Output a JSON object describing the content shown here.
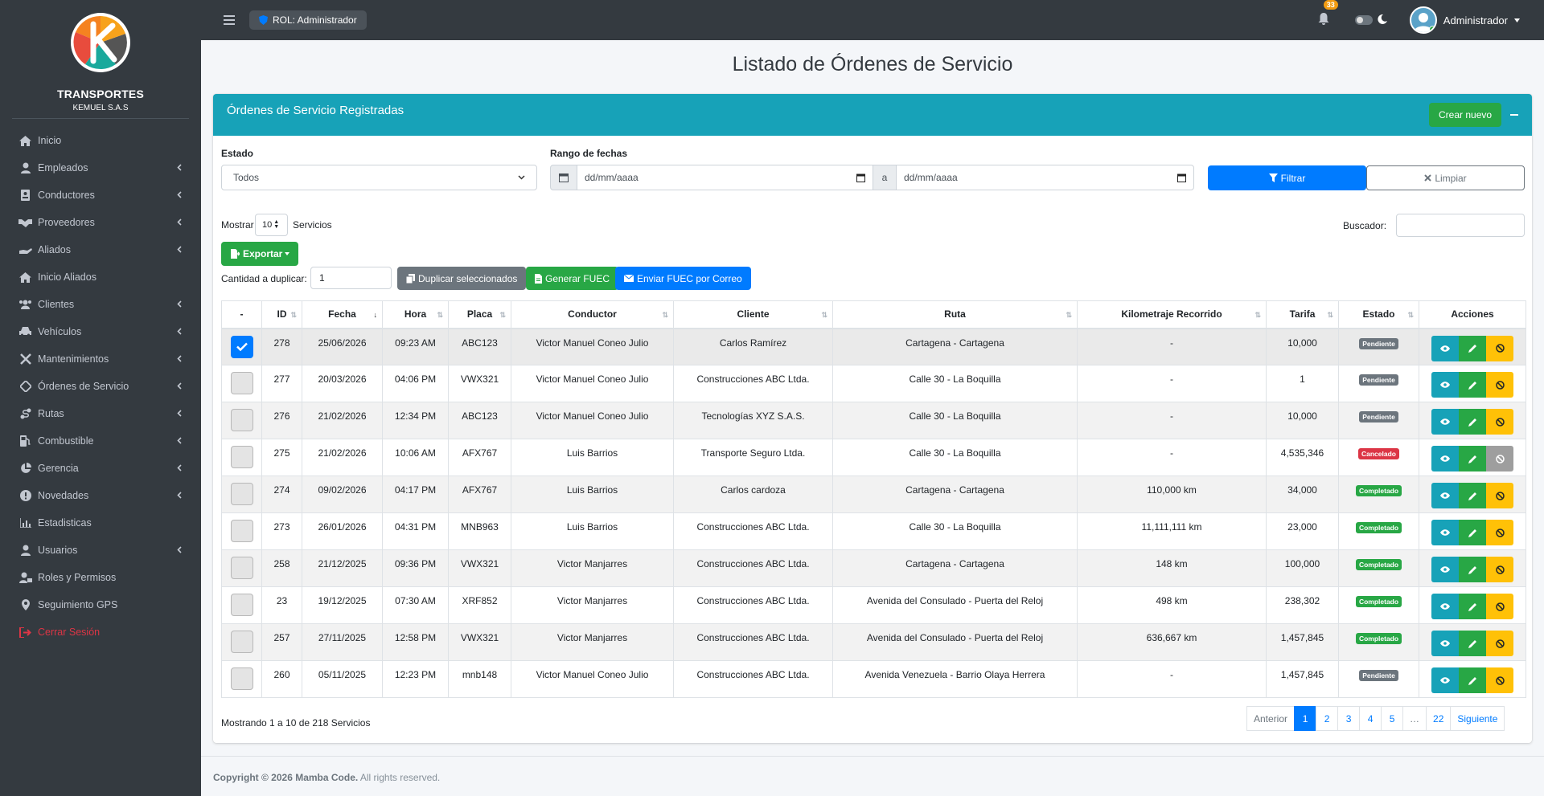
{
  "brand": {
    "name": "TRANSPORTES",
    "subtitle": "KEMUEL S.A.S"
  },
  "sidebar": {
    "items": [
      {
        "label": "Inicio",
        "icon": "home-icon",
        "arrow": false
      },
      {
        "label": "Empleados",
        "icon": "user-tie-icon",
        "arrow": true
      },
      {
        "label": "Conductores",
        "icon": "id-card-icon",
        "arrow": true
      },
      {
        "label": "Proveedores",
        "icon": "handshake-icon",
        "arrow": true
      },
      {
        "label": "Aliados",
        "icon": "hand-holding-icon",
        "arrow": true
      },
      {
        "label": "Inicio Aliados",
        "icon": "home-icon",
        "arrow": false
      },
      {
        "label": "Clientes",
        "icon": "users-icon",
        "arrow": true
      },
      {
        "label": "Vehículos",
        "icon": "car-icon",
        "arrow": true
      },
      {
        "label": "Mantenimientos",
        "icon": "tools-icon",
        "arrow": true
      },
      {
        "label": "Órdenes de Servicio",
        "icon": "clipboard-icon",
        "arrow": true
      },
      {
        "label": "Rutas",
        "icon": "route-icon",
        "arrow": true
      },
      {
        "label": "Combustible",
        "icon": "gas-pump-icon",
        "arrow": true
      },
      {
        "label": "Gerencia",
        "icon": "chart-pie-icon",
        "arrow": true
      },
      {
        "label": "Novedades",
        "icon": "exclamation-circle-icon",
        "arrow": true
      },
      {
        "label": "Estadisticas",
        "icon": "chart-line-icon",
        "arrow": false
      },
      {
        "label": "Usuarios",
        "icon": "user-icon",
        "arrow": true
      },
      {
        "label": "Roles y Permisos",
        "icon": "user-lock-icon",
        "arrow": false
      },
      {
        "label": "Seguimiento GPS",
        "icon": "map-marker-icon",
        "arrow": false
      },
      {
        "label": "Cerrar Sesión",
        "icon": "sign-out-icon",
        "arrow": false
      }
    ]
  },
  "topbar": {
    "role": "ROL: Administrador",
    "notifications": "33",
    "user": "Administrador"
  },
  "page": {
    "title": "Listado de Órdenes de Servicio"
  },
  "card": {
    "title": "Órdenes de Servicio Registradas",
    "create_label": "Crear nuevo"
  },
  "filters": {
    "estado_label": "Estado",
    "estado_value": "Todos",
    "rango_label": "Rango de fechas",
    "date_placeholder": "dd/mm/aaaa",
    "date_sep": "a",
    "filter_label": "Filtrar",
    "clear_label": "Limpiar"
  },
  "controls": {
    "show_label": "Mostrar",
    "show_value": "10",
    "show_suffix": "Servicios",
    "search_label": "Buscador:",
    "export_label": "Exportar",
    "qty_label": "Cantidad a duplicar:",
    "qty_value": "1",
    "dup_label": "Duplicar seleccionados",
    "fuec_label": "Generar FUEC",
    "mail_label": "Enviar FUEC por Correo"
  },
  "table": {
    "headers": [
      "-",
      "ID",
      "Fecha",
      "Hora",
      "Placa",
      "Conductor",
      "Cliente",
      "Ruta",
      "Kilometraje Recorrido",
      "Tarifa",
      "Estado",
      "Acciones"
    ],
    "rows": [
      {
        "id": "278",
        "fecha": "25/06/2026",
        "hora": "09:23 AM",
        "placa": "ABC123",
        "conductor": "Victor Manuel Coneo Julio",
        "cliente": "Carlos Ramírez",
        "ruta": "Cartagena - Cartagena",
        "km": "-",
        "tarifa": "10,000",
        "estado": "Pendiente",
        "checked": true
      },
      {
        "id": "277",
        "fecha": "20/03/2026",
        "hora": "04:06 PM",
        "placa": "VWX321",
        "conductor": "Victor Manuel Coneo Julio",
        "cliente": "Construcciones ABC Ltda.",
        "ruta": "Calle 30 - La Boquilla",
        "km": "-",
        "tarifa": "1",
        "estado": "Pendiente",
        "checked": false
      },
      {
        "id": "276",
        "fecha": "21/02/2026",
        "hora": "12:34 PM",
        "placa": "ABC123",
        "conductor": "Victor Manuel Coneo Julio",
        "cliente": "Tecnologías XYZ S.A.S.",
        "ruta": "Calle 30 - La Boquilla",
        "km": "-",
        "tarifa": "10,000",
        "estado": "Pendiente",
        "checked": false
      },
      {
        "id": "275",
        "fecha": "21/02/2026",
        "hora": "10:06 AM",
        "placa": "AFX767",
        "conductor": "Luis Barrios",
        "cliente": "Transporte Seguro Ltda.",
        "ruta": "Calle 30 - La Boquilla",
        "km": "-",
        "tarifa": "4,535,346",
        "estado": "Cancelado",
        "checked": false
      },
      {
        "id": "274",
        "fecha": "09/02/2026",
        "hora": "04:17 PM",
        "placa": "AFX767",
        "conductor": "Luis Barrios",
        "cliente": "Carlos cardoza",
        "ruta": "Cartagena - Cartagena",
        "km": "110,000 km",
        "tarifa": "34,000",
        "estado": "Completado",
        "checked": false
      },
      {
        "id": "273",
        "fecha": "26/01/2026",
        "hora": "04:31 PM",
        "placa": "MNB963",
        "conductor": "Luis Barrios",
        "cliente": "Construcciones ABC Ltda.",
        "ruta": "Calle 30 - La Boquilla",
        "km": "11,111,111 km",
        "tarifa": "23,000",
        "estado": "Completado",
        "checked": false
      },
      {
        "id": "258",
        "fecha": "21/12/2025",
        "hora": "09:36 PM",
        "placa": "VWX321",
        "conductor": "Victor Manjarres",
        "cliente": "Construcciones ABC Ltda.",
        "ruta": "Cartagena - Cartagena",
        "km": "148 km",
        "tarifa": "100,000",
        "estado": "Completado",
        "checked": false
      },
      {
        "id": "23",
        "fecha": "19/12/2025",
        "hora": "07:30 AM",
        "placa": "XRF852",
        "conductor": "Victor Manjarres",
        "cliente": "Construcciones ABC Ltda.",
        "ruta": "Avenida del Consulado - Puerta del Reloj",
        "km": "498 km",
        "tarifa": "238,302",
        "estado": "Completado",
        "checked": false
      },
      {
        "id": "257",
        "fecha": "27/11/2025",
        "hora": "12:58 PM",
        "placa": "VWX321",
        "conductor": "Victor Manjarres",
        "cliente": "Construcciones ABC Ltda.",
        "ruta": "Avenida del Consulado - Puerta del Reloj",
        "km": "636,667 km",
        "tarifa": "1,457,845",
        "estado": "Completado",
        "checked": false
      },
      {
        "id": "260",
        "fecha": "05/11/2025",
        "hora": "12:23 PM",
        "placa": "mnb148",
        "conductor": "Victor Manuel Coneo Julio",
        "cliente": "Construcciones ABC Ltda.",
        "ruta": "Avenida Venezuela - Barrio Olaya Herrera",
        "km": "-",
        "tarifa": "1,457,845",
        "estado": "Pendiente",
        "checked": false
      }
    ]
  },
  "pagination": {
    "info": "Mostrando 1 a 10 de 218 Servicios",
    "prev": "Anterior",
    "pages": [
      "1",
      "2",
      "3",
      "4",
      "5",
      "…",
      "22"
    ],
    "next": "Siguiente"
  },
  "footer": {
    "copyright": "Copyright © 2026 Mamba Code.",
    "rights": "All rights reserved."
  },
  "colors": {
    "sidebar": "#343a40",
    "header": "#17a2b8",
    "primary": "#007bff",
    "success": "#28a745",
    "warning": "#ffc107",
    "danger": "#dc3545",
    "secondary": "#6c757d"
  }
}
